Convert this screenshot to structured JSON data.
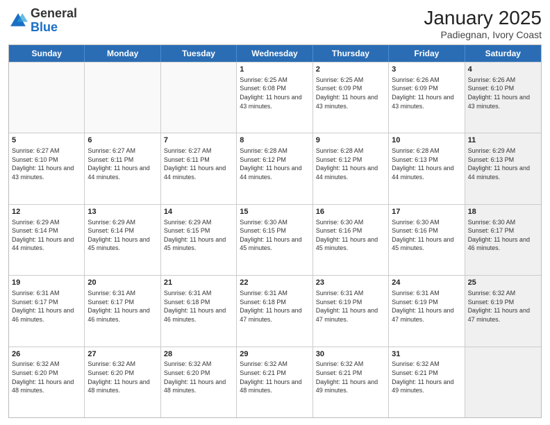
{
  "logo": {
    "general": "General",
    "blue": "Blue"
  },
  "title": "January 2025",
  "subtitle": "Padiegnan, Ivory Coast",
  "header_days": [
    "Sunday",
    "Monday",
    "Tuesday",
    "Wednesday",
    "Thursday",
    "Friday",
    "Saturday"
  ],
  "weeks": [
    [
      {
        "day": "",
        "info": "",
        "empty": true
      },
      {
        "day": "",
        "info": "",
        "empty": true
      },
      {
        "day": "",
        "info": "",
        "empty": true
      },
      {
        "day": "1",
        "info": "Sunrise: 6:25 AM\nSunset: 6:08 PM\nDaylight: 11 hours and 43 minutes.",
        "empty": false
      },
      {
        "day": "2",
        "info": "Sunrise: 6:25 AM\nSunset: 6:09 PM\nDaylight: 11 hours and 43 minutes.",
        "empty": false
      },
      {
        "day": "3",
        "info": "Sunrise: 6:26 AM\nSunset: 6:09 PM\nDaylight: 11 hours and 43 minutes.",
        "empty": false
      },
      {
        "day": "4",
        "info": "Sunrise: 6:26 AM\nSunset: 6:10 PM\nDaylight: 11 hours and 43 minutes.",
        "empty": false,
        "shaded": true
      }
    ],
    [
      {
        "day": "5",
        "info": "Sunrise: 6:27 AM\nSunset: 6:10 PM\nDaylight: 11 hours and 43 minutes.",
        "empty": false
      },
      {
        "day": "6",
        "info": "Sunrise: 6:27 AM\nSunset: 6:11 PM\nDaylight: 11 hours and 44 minutes.",
        "empty": false
      },
      {
        "day": "7",
        "info": "Sunrise: 6:27 AM\nSunset: 6:11 PM\nDaylight: 11 hours and 44 minutes.",
        "empty": false
      },
      {
        "day": "8",
        "info": "Sunrise: 6:28 AM\nSunset: 6:12 PM\nDaylight: 11 hours and 44 minutes.",
        "empty": false
      },
      {
        "day": "9",
        "info": "Sunrise: 6:28 AM\nSunset: 6:12 PM\nDaylight: 11 hours and 44 minutes.",
        "empty": false
      },
      {
        "day": "10",
        "info": "Sunrise: 6:28 AM\nSunset: 6:13 PM\nDaylight: 11 hours and 44 minutes.",
        "empty": false
      },
      {
        "day": "11",
        "info": "Sunrise: 6:29 AM\nSunset: 6:13 PM\nDaylight: 11 hours and 44 minutes.",
        "empty": false,
        "shaded": true
      }
    ],
    [
      {
        "day": "12",
        "info": "Sunrise: 6:29 AM\nSunset: 6:14 PM\nDaylight: 11 hours and 44 minutes.",
        "empty": false
      },
      {
        "day": "13",
        "info": "Sunrise: 6:29 AM\nSunset: 6:14 PM\nDaylight: 11 hours and 45 minutes.",
        "empty": false
      },
      {
        "day": "14",
        "info": "Sunrise: 6:29 AM\nSunset: 6:15 PM\nDaylight: 11 hours and 45 minutes.",
        "empty": false
      },
      {
        "day": "15",
        "info": "Sunrise: 6:30 AM\nSunset: 6:15 PM\nDaylight: 11 hours and 45 minutes.",
        "empty": false
      },
      {
        "day": "16",
        "info": "Sunrise: 6:30 AM\nSunset: 6:16 PM\nDaylight: 11 hours and 45 minutes.",
        "empty": false
      },
      {
        "day": "17",
        "info": "Sunrise: 6:30 AM\nSunset: 6:16 PM\nDaylight: 11 hours and 45 minutes.",
        "empty": false
      },
      {
        "day": "18",
        "info": "Sunrise: 6:30 AM\nSunset: 6:17 PM\nDaylight: 11 hours and 46 minutes.",
        "empty": false,
        "shaded": true
      }
    ],
    [
      {
        "day": "19",
        "info": "Sunrise: 6:31 AM\nSunset: 6:17 PM\nDaylight: 11 hours and 46 minutes.",
        "empty": false
      },
      {
        "day": "20",
        "info": "Sunrise: 6:31 AM\nSunset: 6:17 PM\nDaylight: 11 hours and 46 minutes.",
        "empty": false
      },
      {
        "day": "21",
        "info": "Sunrise: 6:31 AM\nSunset: 6:18 PM\nDaylight: 11 hours and 46 minutes.",
        "empty": false
      },
      {
        "day": "22",
        "info": "Sunrise: 6:31 AM\nSunset: 6:18 PM\nDaylight: 11 hours and 47 minutes.",
        "empty": false
      },
      {
        "day": "23",
        "info": "Sunrise: 6:31 AM\nSunset: 6:19 PM\nDaylight: 11 hours and 47 minutes.",
        "empty": false
      },
      {
        "day": "24",
        "info": "Sunrise: 6:31 AM\nSunset: 6:19 PM\nDaylight: 11 hours and 47 minutes.",
        "empty": false
      },
      {
        "day": "25",
        "info": "Sunrise: 6:32 AM\nSunset: 6:19 PM\nDaylight: 11 hours and 47 minutes.",
        "empty": false,
        "shaded": true
      }
    ],
    [
      {
        "day": "26",
        "info": "Sunrise: 6:32 AM\nSunset: 6:20 PM\nDaylight: 11 hours and 48 minutes.",
        "empty": false
      },
      {
        "day": "27",
        "info": "Sunrise: 6:32 AM\nSunset: 6:20 PM\nDaylight: 11 hours and 48 minutes.",
        "empty": false
      },
      {
        "day": "28",
        "info": "Sunrise: 6:32 AM\nSunset: 6:20 PM\nDaylight: 11 hours and 48 minutes.",
        "empty": false
      },
      {
        "day": "29",
        "info": "Sunrise: 6:32 AM\nSunset: 6:21 PM\nDaylight: 11 hours and 48 minutes.",
        "empty": false
      },
      {
        "day": "30",
        "info": "Sunrise: 6:32 AM\nSunset: 6:21 PM\nDaylight: 11 hours and 49 minutes.",
        "empty": false
      },
      {
        "day": "31",
        "info": "Sunrise: 6:32 AM\nSunset: 6:21 PM\nDaylight: 11 hours and 49 minutes.",
        "empty": false
      },
      {
        "day": "",
        "info": "",
        "empty": true,
        "shaded": true
      }
    ]
  ]
}
